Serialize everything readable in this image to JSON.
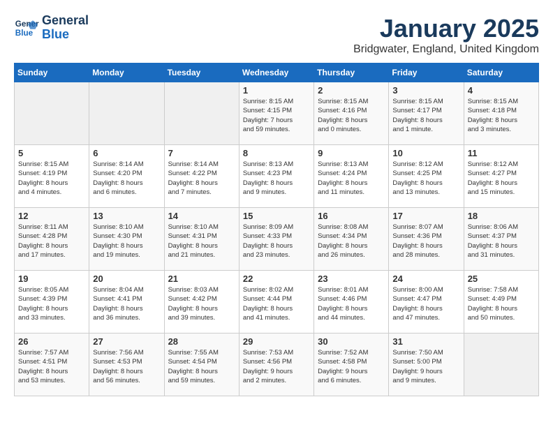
{
  "logo": {
    "line1": "General",
    "line2": "Blue"
  },
  "title": "January 2025",
  "location": "Bridgwater, England, United Kingdom",
  "days_header": [
    "Sunday",
    "Monday",
    "Tuesday",
    "Wednesday",
    "Thursday",
    "Friday",
    "Saturday"
  ],
  "weeks": [
    [
      {
        "day": "",
        "info": ""
      },
      {
        "day": "",
        "info": ""
      },
      {
        "day": "",
        "info": ""
      },
      {
        "day": "1",
        "info": "Sunrise: 8:15 AM\nSunset: 4:15 PM\nDaylight: 7 hours\nand 59 minutes."
      },
      {
        "day": "2",
        "info": "Sunrise: 8:15 AM\nSunset: 4:16 PM\nDaylight: 8 hours\nand 0 minutes."
      },
      {
        "day": "3",
        "info": "Sunrise: 8:15 AM\nSunset: 4:17 PM\nDaylight: 8 hours\nand 1 minute."
      },
      {
        "day": "4",
        "info": "Sunrise: 8:15 AM\nSunset: 4:18 PM\nDaylight: 8 hours\nand 3 minutes."
      }
    ],
    [
      {
        "day": "5",
        "info": "Sunrise: 8:15 AM\nSunset: 4:19 PM\nDaylight: 8 hours\nand 4 minutes."
      },
      {
        "day": "6",
        "info": "Sunrise: 8:14 AM\nSunset: 4:20 PM\nDaylight: 8 hours\nand 6 minutes."
      },
      {
        "day": "7",
        "info": "Sunrise: 8:14 AM\nSunset: 4:22 PM\nDaylight: 8 hours\nand 7 minutes."
      },
      {
        "day": "8",
        "info": "Sunrise: 8:13 AM\nSunset: 4:23 PM\nDaylight: 8 hours\nand 9 minutes."
      },
      {
        "day": "9",
        "info": "Sunrise: 8:13 AM\nSunset: 4:24 PM\nDaylight: 8 hours\nand 11 minutes."
      },
      {
        "day": "10",
        "info": "Sunrise: 8:12 AM\nSunset: 4:25 PM\nDaylight: 8 hours\nand 13 minutes."
      },
      {
        "day": "11",
        "info": "Sunrise: 8:12 AM\nSunset: 4:27 PM\nDaylight: 8 hours\nand 15 minutes."
      }
    ],
    [
      {
        "day": "12",
        "info": "Sunrise: 8:11 AM\nSunset: 4:28 PM\nDaylight: 8 hours\nand 17 minutes."
      },
      {
        "day": "13",
        "info": "Sunrise: 8:10 AM\nSunset: 4:30 PM\nDaylight: 8 hours\nand 19 minutes."
      },
      {
        "day": "14",
        "info": "Sunrise: 8:10 AM\nSunset: 4:31 PM\nDaylight: 8 hours\nand 21 minutes."
      },
      {
        "day": "15",
        "info": "Sunrise: 8:09 AM\nSunset: 4:33 PM\nDaylight: 8 hours\nand 23 minutes."
      },
      {
        "day": "16",
        "info": "Sunrise: 8:08 AM\nSunset: 4:34 PM\nDaylight: 8 hours\nand 26 minutes."
      },
      {
        "day": "17",
        "info": "Sunrise: 8:07 AM\nSunset: 4:36 PM\nDaylight: 8 hours\nand 28 minutes."
      },
      {
        "day": "18",
        "info": "Sunrise: 8:06 AM\nSunset: 4:37 PM\nDaylight: 8 hours\nand 31 minutes."
      }
    ],
    [
      {
        "day": "19",
        "info": "Sunrise: 8:05 AM\nSunset: 4:39 PM\nDaylight: 8 hours\nand 33 minutes."
      },
      {
        "day": "20",
        "info": "Sunrise: 8:04 AM\nSunset: 4:41 PM\nDaylight: 8 hours\nand 36 minutes."
      },
      {
        "day": "21",
        "info": "Sunrise: 8:03 AM\nSunset: 4:42 PM\nDaylight: 8 hours\nand 39 minutes."
      },
      {
        "day": "22",
        "info": "Sunrise: 8:02 AM\nSunset: 4:44 PM\nDaylight: 8 hours\nand 41 minutes."
      },
      {
        "day": "23",
        "info": "Sunrise: 8:01 AM\nSunset: 4:46 PM\nDaylight: 8 hours\nand 44 minutes."
      },
      {
        "day": "24",
        "info": "Sunrise: 8:00 AM\nSunset: 4:47 PM\nDaylight: 8 hours\nand 47 minutes."
      },
      {
        "day": "25",
        "info": "Sunrise: 7:58 AM\nSunset: 4:49 PM\nDaylight: 8 hours\nand 50 minutes."
      }
    ],
    [
      {
        "day": "26",
        "info": "Sunrise: 7:57 AM\nSunset: 4:51 PM\nDaylight: 8 hours\nand 53 minutes."
      },
      {
        "day": "27",
        "info": "Sunrise: 7:56 AM\nSunset: 4:53 PM\nDaylight: 8 hours\nand 56 minutes."
      },
      {
        "day": "28",
        "info": "Sunrise: 7:55 AM\nSunset: 4:54 PM\nDaylight: 8 hours\nand 59 minutes."
      },
      {
        "day": "29",
        "info": "Sunrise: 7:53 AM\nSunset: 4:56 PM\nDaylight: 9 hours\nand 2 minutes."
      },
      {
        "day": "30",
        "info": "Sunrise: 7:52 AM\nSunset: 4:58 PM\nDaylight: 9 hours\nand 6 minutes."
      },
      {
        "day": "31",
        "info": "Sunrise: 7:50 AM\nSunset: 5:00 PM\nDaylight: 9 hours\nand 9 minutes."
      },
      {
        "day": "",
        "info": ""
      }
    ]
  ]
}
